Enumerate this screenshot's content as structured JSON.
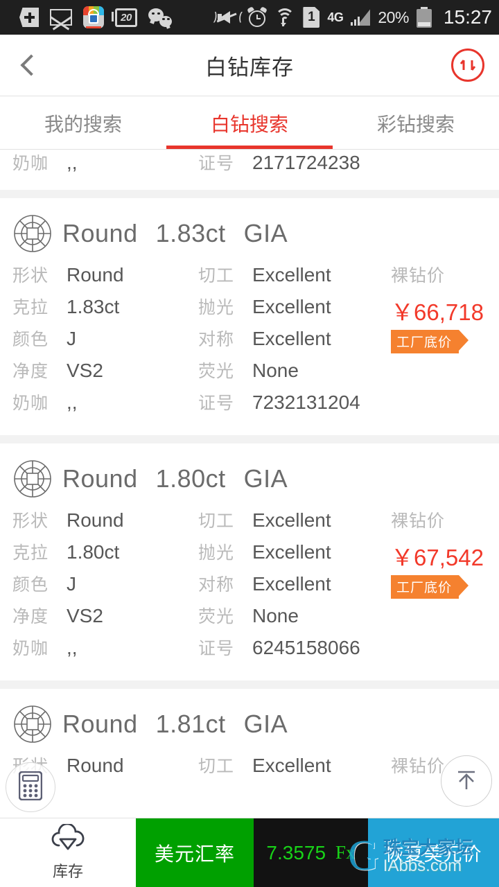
{
  "status_bar": {
    "calendar_badge": "20",
    "network": "4G",
    "battery_percent": "20%",
    "time": "15:27",
    "icons": [
      "add-icon",
      "mail-icon",
      "app-icon",
      "calendar-icon",
      "wechat-icon",
      "mute-icon",
      "alarm-icon",
      "wifi-icon",
      "sim1-icon",
      "signal-icon",
      "battery-icon"
    ]
  },
  "header": {
    "back_label": "‹",
    "title": "白钻库存",
    "sort_icon": "sort-updown-icon",
    "accent_color": "#e8352c"
  },
  "tabs": [
    {
      "label": "我的搜索",
      "active": false
    },
    {
      "label": "白钻搜索",
      "active": true
    },
    {
      "label": "彩钻搜索",
      "active": false
    }
  ],
  "labels": {
    "shape": "形状",
    "carat": "克拉",
    "color": "颜色",
    "clarity": "净度",
    "milky": "奶咖",
    "cut": "切工",
    "polish": "抛光",
    "symmetry": "对称",
    "fluorescence": "荧光",
    "cert_no": "证号",
    "price_label": "裸钻价",
    "tag": "工厂底价"
  },
  "cards": [
    {
      "partial_top": true,
      "title": {
        "shape": "",
        "carat": "",
        "lab": ""
      },
      "milky": ",,",
      "cert_no": "2171724238"
    },
    {
      "partial_top": false,
      "title": {
        "shape": "Round",
        "carat": "1.83ct",
        "lab": "GIA"
      },
      "shape": "Round",
      "carat": "1.83ct",
      "color": "J",
      "clarity": "VS2",
      "milky": ",,",
      "cut": "Excellent",
      "polish": "Excellent",
      "symmetry": "Excellent",
      "fluorescence": "None",
      "cert_no": "7232131204",
      "price": "￥66,718",
      "tag": "工厂底价"
    },
    {
      "partial_top": false,
      "title": {
        "shape": "Round",
        "carat": "1.80ct",
        "lab": "GIA"
      },
      "shape": "Round",
      "carat": "1.80ct",
      "color": "J",
      "clarity": "VS2",
      "milky": ",,",
      "cut": "Excellent",
      "polish": "Excellent",
      "symmetry": "Excellent",
      "fluorescence": "None",
      "cert_no": "6245158066",
      "price": "￥67,542",
      "tag": "工厂底价"
    },
    {
      "partial_bottom": true,
      "title": {
        "shape": "Round",
        "carat": "1.81ct",
        "lab": "GIA"
      },
      "shape": "Round",
      "cut": "Excellent",
      "price_label": "裸钻价"
    }
  ],
  "floating": {
    "calculator_icon": "calculator-icon",
    "scroll_top_icon": "arrow-up-icon"
  },
  "bottom_bar": {
    "inventory_label": "库存",
    "inventory_icon": "cloud-diamond-icon",
    "rate_label": "美元汇率",
    "rate_value": "7.3575",
    "fx_label": "Fx",
    "restore_label": "恢复美元价",
    "colors": {
      "rate_bg": "#00a000",
      "value_bg": "#121212",
      "value_text": "#18d318",
      "restore_bg": "#22a3d6"
    }
  },
  "watermark": {
    "logo": "G",
    "line1": "珠宝大家坛",
    "line2": "IAbbs.com"
  }
}
